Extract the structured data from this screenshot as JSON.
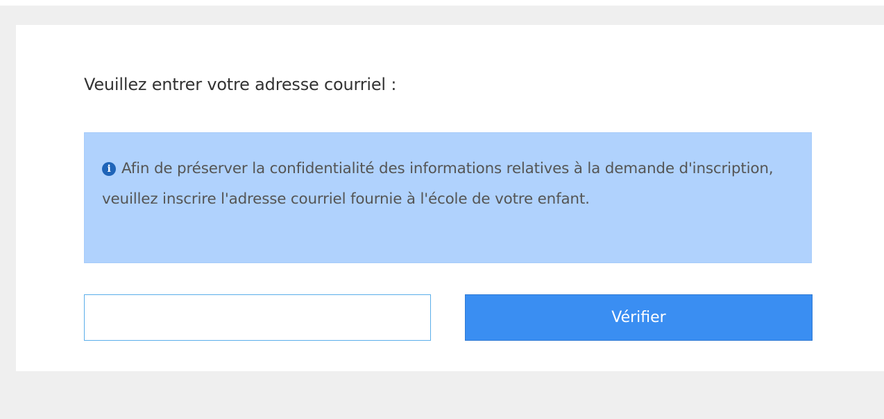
{
  "form": {
    "prompt": "Veuillez entrer votre adresse courriel :",
    "info_icon": "info-circle-icon",
    "info_icon_glyph": "i",
    "info_text": "Afin de préserver la confidentialité des informations relatives à la demande d'inscription, veuillez inscrire l'adresse courriel fournie à l'école de votre enfant.",
    "email_value": "",
    "email_placeholder": "",
    "verify_label": "Vérifier"
  },
  "colors": {
    "page_background": "#efefef",
    "card_background": "#ffffff",
    "info_background": "#b0d2fd",
    "info_icon": "#1f64b8",
    "button_background": "#3a8ef2",
    "input_border": "#5aaeea"
  }
}
